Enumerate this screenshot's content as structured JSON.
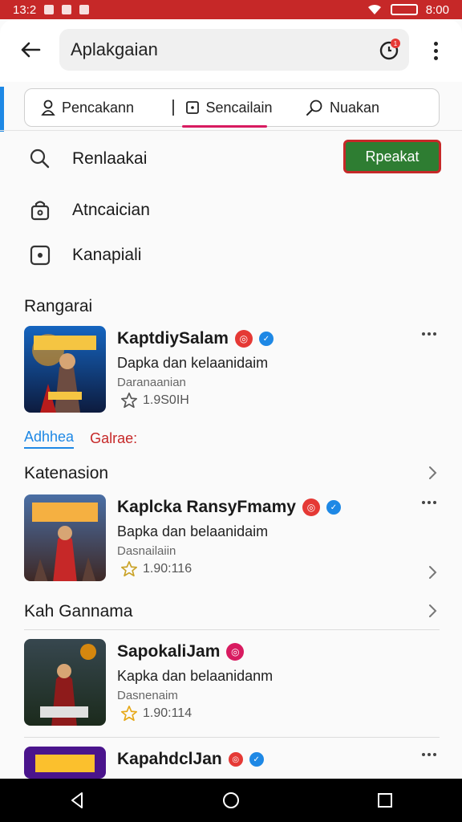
{
  "status_bar": {
    "time_left": "13:2",
    "time_right": "8:00"
  },
  "header": {
    "search_value": "Aplakgaian",
    "notification_count": "1"
  },
  "tabs": [
    {
      "label": "Pencakann",
      "icon": "person-icon"
    },
    {
      "label": "Sencailain",
      "icon": "square-icon"
    },
    {
      "label": "Nuakan",
      "icon": "search-icon"
    }
  ],
  "quick_actions": [
    {
      "label": "Renlaakai",
      "icon": "search-icon"
    },
    {
      "label": "Atncaician",
      "icon": "bag-icon"
    },
    {
      "label": "Kanapiali",
      "icon": "square-icon"
    }
  ],
  "cta_button": "Rpeakat",
  "sections": {
    "first": "Rangarai",
    "second": "Katenasion",
    "third": "Kah Gannama"
  },
  "chips": {
    "blue": "Adhhea",
    "red": "Galrae:"
  },
  "apps": [
    {
      "title": "KaptdiySalam",
      "subtitle": "Dapka dan kelaanidaim",
      "meta": "Daranaanian",
      "rating": "1.9S0IH",
      "badges": [
        "red",
        "blue"
      ]
    },
    {
      "title": "Kaplcka RansyFmamy",
      "subtitle": "Bapka dan belaanidaim",
      "meta": "Dasnailaiin",
      "rating": "1.90:116",
      "badges": [
        "red",
        "blue"
      ]
    },
    {
      "title": "SapokaliJam",
      "subtitle": "Kapka dan belaanidanm",
      "meta": "Dasnenaim",
      "rating": "1.90:114",
      "badges": [
        "pink"
      ]
    },
    {
      "title": "KapahdclJan",
      "subtitle": "",
      "meta": "",
      "rating": "",
      "badges": [
        "red",
        "blue"
      ]
    }
  ],
  "colors": {
    "status_bar": "#c62828",
    "accent_pink": "#d81b60",
    "cta_green": "#2e7d32",
    "blue": "#1e88e5"
  }
}
